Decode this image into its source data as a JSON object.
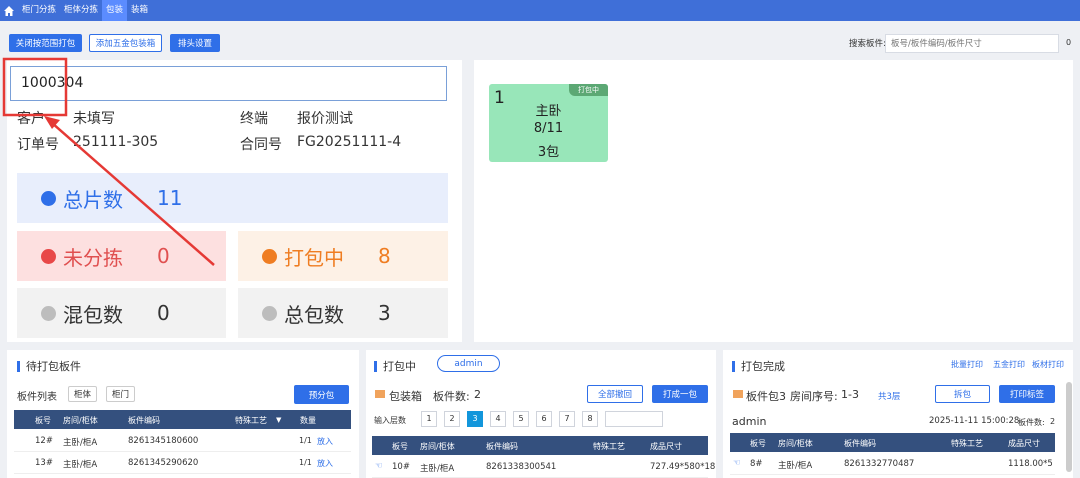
{
  "nav": {
    "tabs": [
      {
        "label": "柜门分拣"
      },
      {
        "label": "柜体分拣"
      },
      {
        "label": "包装"
      },
      {
        "label": "装箱"
      }
    ]
  },
  "toolbar": {
    "close_range_label": "关闭按范围打包",
    "add_hardware_label": "添加五金包装箱",
    "sort_settings_label": "排头设置"
  },
  "search": {
    "label": "搜索板件:",
    "placeholder": "板号/板件编码/板件尺寸",
    "count": "0"
  },
  "order": {
    "input_value": "1000304",
    "customer_label": "客户",
    "customer_value": "未填写",
    "terminal_label": "终端",
    "terminal_value": "报价测试",
    "order_no_label": "订单号",
    "order_no_value": "251111-305",
    "contract_label": "合同号",
    "contract_value": "FG20251111-4"
  },
  "stats": {
    "total_label": "总片数",
    "total_value": "11",
    "unsorted_label": "未分拣",
    "unsorted_value": "0",
    "packing_label": "打包中",
    "packing_value": "8",
    "mixed_label": "混包数",
    "mixed_value": "0",
    "total_pkg_label": "总包数",
    "total_pkg_value": "3"
  },
  "card": {
    "badge": "打包中",
    "index": "1",
    "room": "主卧",
    "progress": "8/11",
    "packages": "3包"
  },
  "pending": {
    "title": "待打包板件",
    "list_label": "板件列表",
    "filter_cabinet": "柜体",
    "filter_door": "柜门",
    "pre_pack": "预分包",
    "headers": [
      "板号",
      "房间/柜体",
      "板件编码",
      "特殊工艺",
      "数量"
    ],
    "rows": [
      {
        "no": "12#",
        "room": "主卧/柜A",
        "code": "8261345180600",
        "qty": "1/1",
        "action": "放入"
      },
      {
        "no": "13#",
        "room": "主卧/柜A",
        "code": "8261345290620",
        "qty": "1/1",
        "action": "放入"
      }
    ]
  },
  "packing": {
    "title": "打包中",
    "user": "admin",
    "box_label": "包装箱",
    "count_label": "板件数:",
    "count_value": "2",
    "withdraw_all": "全部撤回",
    "pack_one": "打成一包",
    "layer_label": "输入层数",
    "pages": [
      "1",
      "2",
      "3",
      "4",
      "5",
      "6",
      "7",
      "8"
    ],
    "headers": [
      "板号",
      "房间/柜体",
      "板件编码",
      "特殊工艺",
      "成品尺寸"
    ],
    "rows": [
      {
        "no": "10#",
        "room": "主卧/柜A",
        "code": "8261338300541",
        "size": "727.49*580*18"
      }
    ]
  },
  "done": {
    "title": "打包完成",
    "batch_print": "批量打印",
    "hardware_print": "五金打印",
    "board_print": "板材打印",
    "pkg_label": "板件包3",
    "room_seq_label": "房间序号:",
    "room_seq_value": "1-3",
    "layers": "共3层",
    "unpack": "拆包",
    "print_label": "打印标签",
    "user": "admin",
    "time": "2025-11-11 15:00:28",
    "count_label": "板件数:",
    "count_value": "2",
    "headers": [
      "板号",
      "房间/柜体",
      "板件编码",
      "特殊工艺",
      "成品尺寸"
    ],
    "rows": [
      {
        "no": "8#",
        "room": "主卧/柜A",
        "code": "8261332770487",
        "size": "1118.00*5"
      }
    ]
  },
  "colors": {
    "accent": "#2f6fe8",
    "nav": "#3f6fd8",
    "card_green": "#98e6b9",
    "annotation_red": "#e53935"
  }
}
